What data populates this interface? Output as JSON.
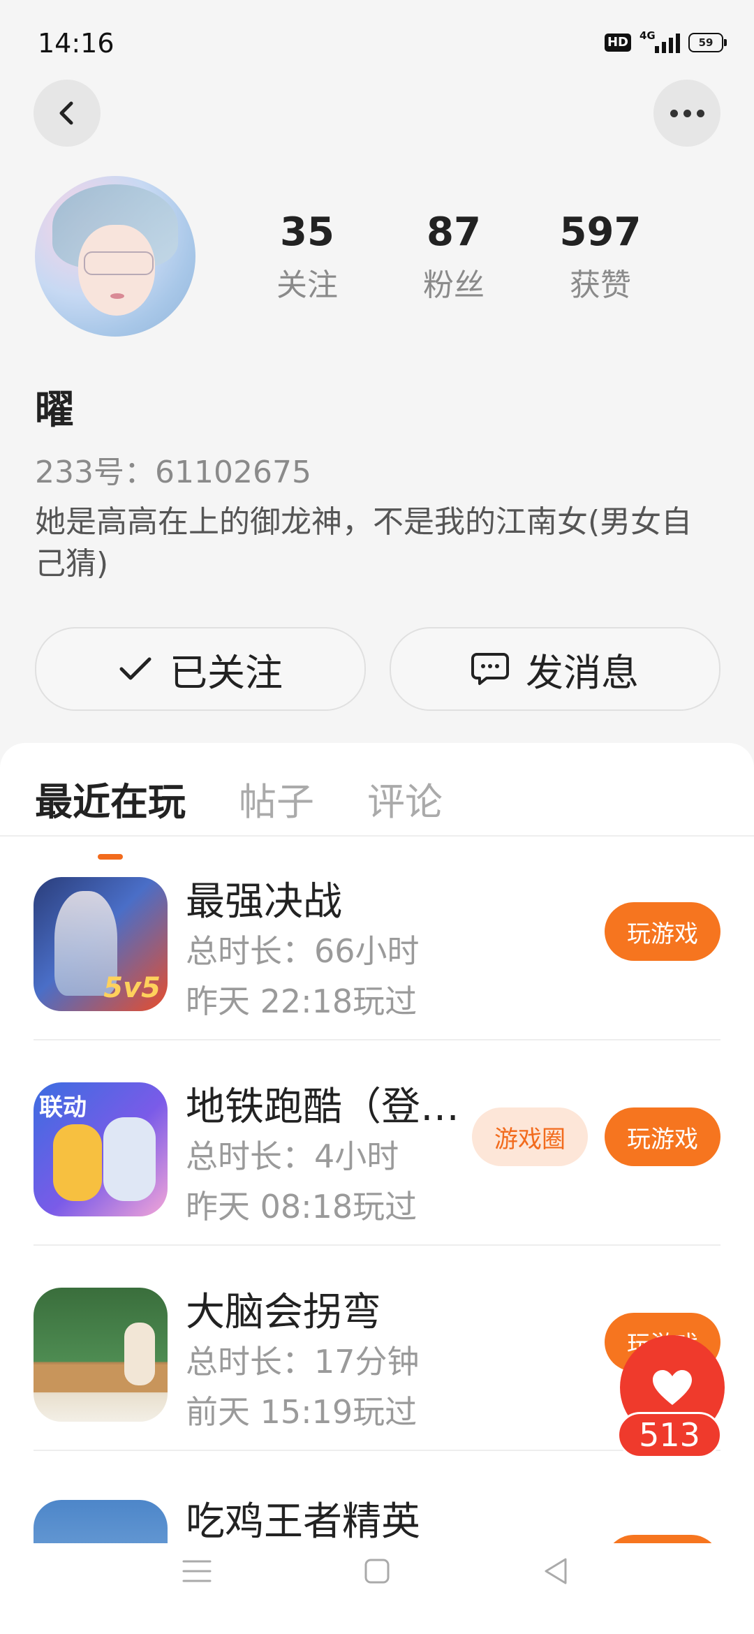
{
  "status": {
    "time": "14:16",
    "hd": "HD",
    "network": "4G",
    "battery": "59"
  },
  "profile": {
    "following_count": "35",
    "following_label": "关注",
    "fans_count": "87",
    "fans_label": "粉丝",
    "likes_count": "597",
    "likes_label": "获赞",
    "nickname": "曜",
    "uid": "233号：61102675",
    "bio": "她是高高在上的御龙神，不是我的江南女(男女自己猜)"
  },
  "actions": {
    "follow_label": "已关注",
    "message_label": "发消息"
  },
  "tabs": [
    {
      "label": "最近在玩"
    },
    {
      "label": "帖子"
    },
    {
      "label": "评论"
    }
  ],
  "games": [
    {
      "name": "最强决战",
      "duration": "总时长：66小时",
      "last_played": "昨天 22:18玩过",
      "play_label": "玩游戏",
      "icon_badge": "5v5"
    },
    {
      "name": "地铁跑酷（登…",
      "duration": "总时长：4小时",
      "last_played": "昨天 08:18玩过",
      "play_label": "玩游戏",
      "circle_label": "游戏圈",
      "icon_badge": "联动"
    },
    {
      "name": "大脑会拐弯",
      "duration": "总时长：17分钟",
      "last_played": "前天 15:19玩过",
      "play_label": "玩游戏"
    },
    {
      "name": "吃鸡王者精英"
    }
  ],
  "like": {
    "count": "513"
  },
  "colors": {
    "accent": "#f6751f",
    "like": "#ef3a2c"
  }
}
